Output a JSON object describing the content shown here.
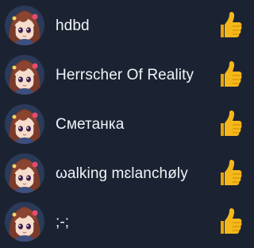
{
  "reactions": {
    "reaction_icon": "thumbs-up-icon",
    "reaction_color": "#f5b81b",
    "users": [
      {
        "name": "hdbd",
        "avatar_icon": "anime-girl-avatar"
      },
      {
        "name": "Herrscher Of Reality",
        "avatar_icon": "anime-girl-avatar"
      },
      {
        "name": "Сметанка",
        "avatar_icon": "anime-girl-avatar"
      },
      {
        "name": "ωalkinɡ mɛlanchøly",
        "avatar_icon": "anime-girl-avatar"
      },
      {
        "name": ";-;",
        "avatar_icon": "anime-girl-avatar"
      }
    ]
  }
}
